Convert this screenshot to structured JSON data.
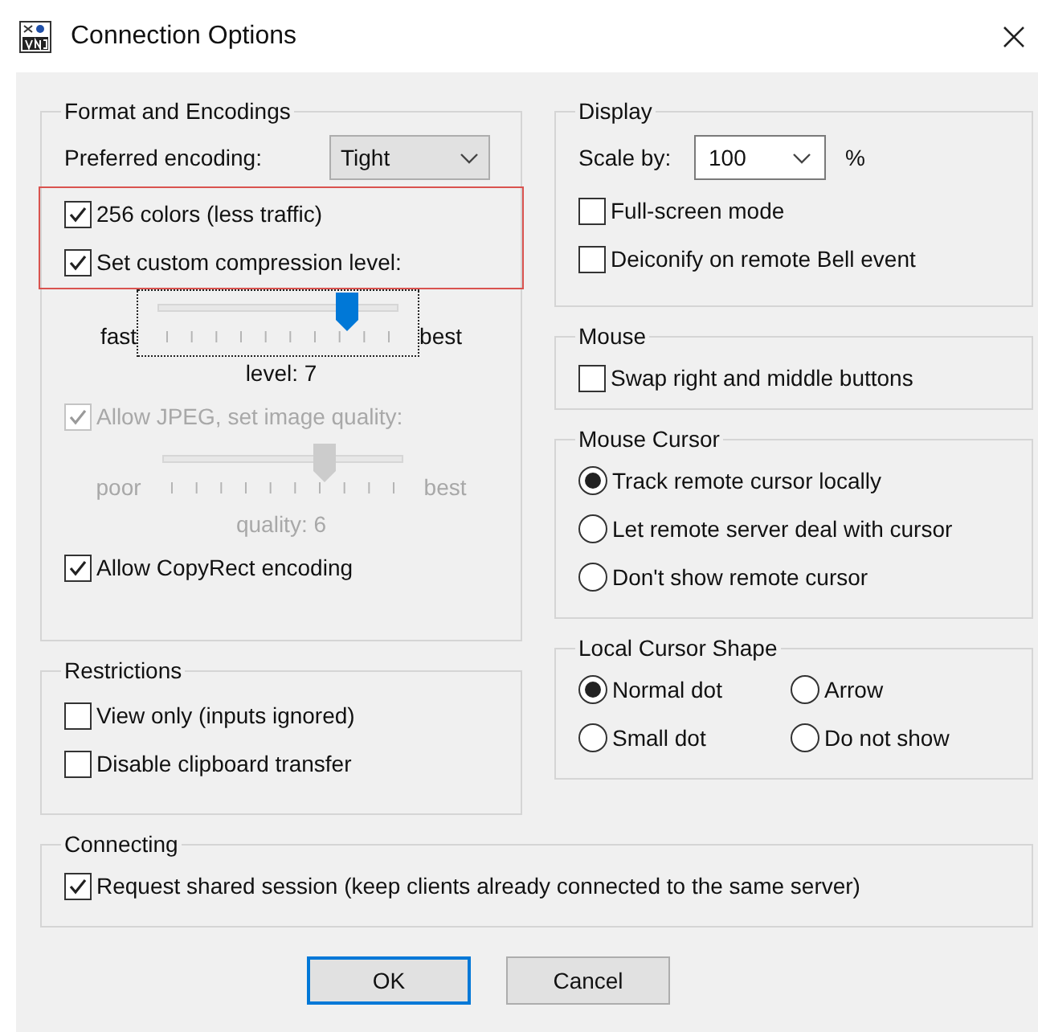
{
  "window": {
    "title": "Connection Options"
  },
  "format": {
    "title": "Format and Encodings",
    "items": [
      {
        "kind": "dropdown",
        "label": "Preferred encoding:",
        "value": "Tight"
      },
      {
        "kind": "highlight",
        "items": [
          {
            "kind": "checkbox",
            "label": "256 colors (less traffic)",
            "checked": true,
            "disabled": false
          },
          {
            "kind": "checkbox",
            "label": "Set custom compression level:",
            "checked": true,
            "disabled": false
          }
        ]
      },
      {
        "kind": "slider",
        "min_label": "fast",
        "max_label": "best",
        "level": 0.78,
        "reading": "level: 7",
        "focused": true,
        "disabled": false
      },
      {
        "kind": "checkbox",
        "label": "Allow JPEG, set image quality:",
        "checked": true,
        "disabled": true
      },
      {
        "kind": "slider",
        "min_label": "poor",
        "max_label": "best",
        "level": 0.67,
        "reading": "quality: 6",
        "focused": false,
        "disabled": true
      },
      {
        "kind": "checkbox",
        "label": "Allow CopyRect encoding",
        "checked": true,
        "disabled": false
      }
    ]
  },
  "restrictions": {
    "title": "Restrictions",
    "items": [
      {
        "label": "View only (inputs ignored)",
        "checked": false
      },
      {
        "label": "Disable clipboard transfer",
        "checked": false
      }
    ]
  },
  "display": {
    "title": "Display",
    "scale_label": "Scale by:",
    "scale_value": "100",
    "unit": "%",
    "items": [
      {
        "label": "Full-screen mode",
        "checked": false
      },
      {
        "label": "Deiconify on remote Bell event",
        "checked": false
      }
    ]
  },
  "mouse": {
    "title": "Mouse",
    "items": [
      {
        "label": "Swap right and middle buttons",
        "checked": false
      }
    ]
  },
  "mouse_cursor": {
    "title": "Mouse Cursor",
    "options": [
      {
        "label": "Track remote cursor locally",
        "selected": true
      },
      {
        "label": "Let remote server deal with cursor",
        "selected": false
      },
      {
        "label": "Don't show remote cursor",
        "selected": false
      }
    ]
  },
  "local_cursor": {
    "title": "Local Cursor Shape",
    "options": [
      {
        "label": "Normal dot",
        "selected": true
      },
      {
        "label": "Arrow",
        "selected": false
      },
      {
        "label": "Small dot",
        "selected": false
      },
      {
        "label": "Do not show",
        "selected": false
      }
    ]
  },
  "connecting": {
    "title": "Connecting",
    "items": [
      {
        "label": "Request shared session (keep clients already connected to the same server)",
        "checked": true
      }
    ]
  },
  "buttons": [
    {
      "label": "OK",
      "default": true
    },
    {
      "label": "Cancel",
      "default": false
    }
  ]
}
